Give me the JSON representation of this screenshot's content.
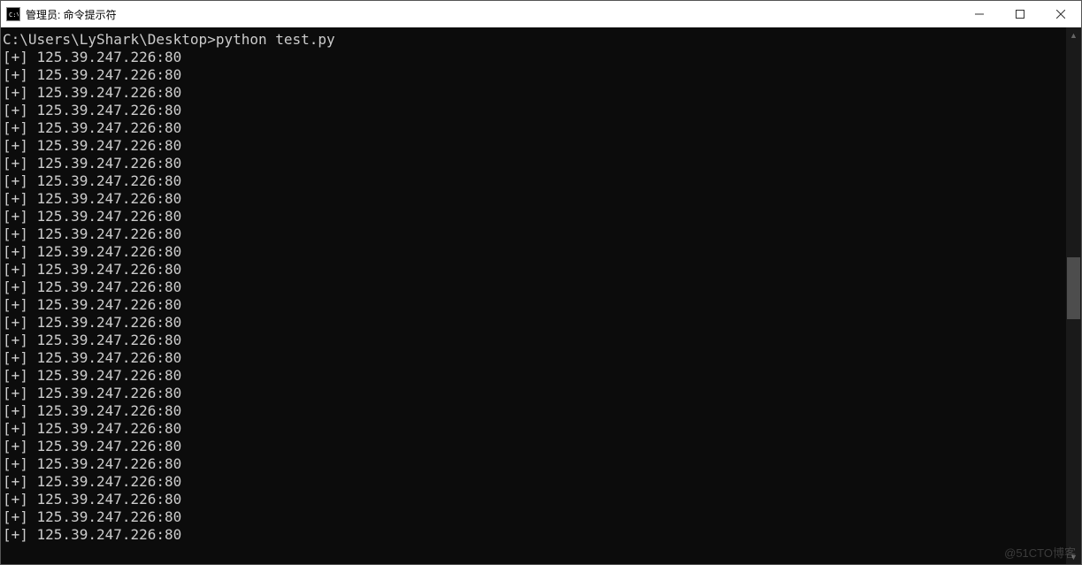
{
  "window": {
    "title": "管理员: 命令提示符"
  },
  "terminal": {
    "prompt": "C:\\Users\\LyShark\\Desktop>",
    "command": "python test.py",
    "line_prefix": "[+] ",
    "output_value": "125.39.247.226:80",
    "output_count": 28
  },
  "watermark": "@51CTO博客"
}
